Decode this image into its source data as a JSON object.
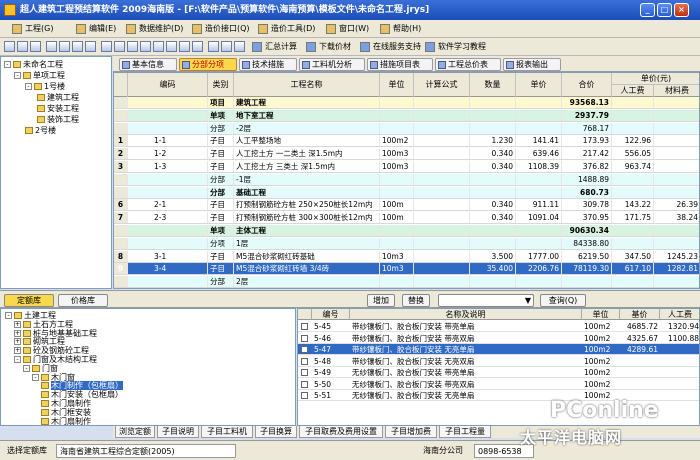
{
  "window": {
    "title": "超人建筑工程预结算软件 2009海南版 - [F:\\软件产品\\预算软件\\海南预算\\模板文件\\未命名工程.jrys]"
  },
  "menu": [
    "工程(G)",
    "编辑(E)",
    "数据维护(D)",
    "造价接口(Q)",
    "造价工具(D)",
    "窗口(W)",
    "帮助(H)"
  ],
  "toolbar": {
    "summary": "汇总计算",
    "download": "下载价材",
    "online": "在线服务支持",
    "tutorial": "软件学习教程"
  },
  "project_tree": [
    {
      "label": "未命名工程",
      "level": 0,
      "toggle": "-"
    },
    {
      "label": "单项工程",
      "level": 1,
      "toggle": "-"
    },
    {
      "label": "1号楼",
      "level": 2,
      "toggle": "-"
    },
    {
      "label": "建筑工程",
      "level": 3,
      "toggle": ""
    },
    {
      "label": "安装工程",
      "level": 3,
      "toggle": ""
    },
    {
      "label": "装饰工程",
      "level": 3,
      "toggle": ""
    },
    {
      "label": "2号楼",
      "level": 2,
      "toggle": ""
    }
  ],
  "tabs": [
    "基本信息",
    "分部分项",
    "技术措施",
    "工料机分析",
    "措施项目表",
    "工程总价表",
    "报表输出"
  ],
  "grid": {
    "headers": {
      "code": "编码",
      "type": "类别",
      "name": "工程名称",
      "unit": "单位",
      "formula": "计算公式",
      "qty": "数量",
      "price": "单价",
      "total": "合价",
      "unit_price": "单价(元)",
      "labor": "人工费",
      "material": "材料费"
    },
    "rows": [
      {
        "n": "",
        "code": "",
        "type": "项目",
        "name": "建筑工程",
        "unit": "",
        "formula": "",
        "qty": "",
        "price": "",
        "total": "93568.13",
        "labor": "",
        "mat": "",
        "style": "bg-yellow bold"
      },
      {
        "n": "",
        "code": "",
        "type": "单项",
        "name": "地下室工程",
        "unit": "",
        "formula": "",
        "qty": "",
        "price": "",
        "total": "2937.79",
        "labor": "",
        "mat": "",
        "style": "bg-green bold"
      },
      {
        "n": "",
        "code": "",
        "type": "分部",
        "name": "-2层",
        "unit": "",
        "formula": "",
        "qty": "",
        "price": "",
        "total": "768.17",
        "labor": "",
        "mat": "",
        "style": "bg-cyan"
      },
      {
        "n": "1",
        "code": "1-1",
        "type": "子目",
        "name": "人工平整场地",
        "unit": "100m2",
        "formula": "",
        "qty": "1.230",
        "price": "141.41",
        "total": "173.93",
        "labor": "122.96",
        "mat": "",
        "style": ""
      },
      {
        "n": "2",
        "code": "1-2",
        "type": "子目",
        "name": "人工挖土方 一二类土 深1.5m内",
        "unit": "100m3",
        "formula": "",
        "qty": "0.340",
        "price": "639.46",
        "total": "217.42",
        "labor": "556.05",
        "mat": "",
        "style": ""
      },
      {
        "n": "3",
        "code": "1-3",
        "type": "子目",
        "name": "人工挖土方 三类土 深1.5m内",
        "unit": "100m3",
        "formula": "",
        "qty": "0.340",
        "price": "1108.39",
        "total": "376.82",
        "labor": "963.74",
        "mat": "",
        "style": ""
      },
      {
        "n": "",
        "code": "",
        "type": "分部",
        "name": "-1层",
        "unit": "",
        "formula": "",
        "qty": "",
        "price": "",
        "total": "1488.89",
        "labor": "",
        "mat": "",
        "style": "bg-cyan"
      },
      {
        "n": "",
        "code": "",
        "type": "分部",
        "name": "基础工程",
        "unit": "",
        "formula": "",
        "qty": "",
        "price": "",
        "total": "680.73",
        "labor": "",
        "mat": "",
        "style": "bg-cyan bold"
      },
      {
        "n": "6",
        "code": "2-1",
        "type": "子目",
        "name": "打预制钢筋砼方桩 250×250桩长12m内",
        "unit": "100m",
        "formula": "",
        "qty": "0.340",
        "price": "911.11",
        "total": "309.78",
        "labor": "143.22",
        "mat": "26.39",
        "style": ""
      },
      {
        "n": "7",
        "code": "2-3",
        "type": "子目",
        "name": "打预制钢筋砼方桩 300×300桩长12m内",
        "unit": "100m",
        "formula": "",
        "qty": "0.340",
        "price": "1091.04",
        "total": "370.95",
        "labor": "171.75",
        "mat": "38.24",
        "style": ""
      },
      {
        "n": "",
        "code": "",
        "type": "单项",
        "name": "主体工程",
        "unit": "",
        "formula": "",
        "qty": "",
        "price": "",
        "total": "90630.34",
        "labor": "",
        "mat": "",
        "style": "bg-green bold"
      },
      {
        "n": "",
        "code": "",
        "type": "分项",
        "name": "1层",
        "unit": "",
        "formula": "",
        "qty": "",
        "price": "",
        "total": "84338.80",
        "labor": "",
        "mat": "",
        "style": "bg-cyan"
      },
      {
        "n": "8",
        "code": "3-1",
        "type": "子目",
        "name": "M5混合砂浆砌红砖基础",
        "unit": "10m3",
        "formula": "",
        "qty": "3.500",
        "price": "1777.00",
        "total": "6219.50",
        "labor": "347.50",
        "mat": "1245.23",
        "style": ""
      },
      {
        "n": "9",
        "code": "3-4",
        "type": "子目",
        "name": "M5混合砂浆砌红砖墙 3/4砖",
        "unit": "10m3",
        "formula": "",
        "qty": "35.400",
        "price": "2206.76",
        "total": "78119.30",
        "labor": "617.10",
        "mat": "1282.81",
        "style": "sel"
      },
      {
        "n": "",
        "code": "",
        "type": "分部",
        "name": "2层",
        "unit": "",
        "formula": "",
        "qty": "",
        "price": "",
        "total": "",
        "labor": "",
        "mat": "",
        "style": "bg-cyan"
      }
    ]
  },
  "midbar": {
    "tab1": "定额库",
    "tab2": "价格库",
    "add": "增加",
    "replace": "替换",
    "query": "查询(Q)"
  },
  "lib_tree": [
    {
      "label": "土建工程",
      "level": 0,
      "toggle": "-"
    },
    {
      "label": "土石方工程",
      "level": 1,
      "toggle": "+"
    },
    {
      "label": "桩与地基基础工程",
      "level": 1,
      "toggle": "+"
    },
    {
      "label": "砌筑工程",
      "level": 1,
      "toggle": "+"
    },
    {
      "label": "砼及钢筋砼工程",
      "level": 1,
      "toggle": "+"
    },
    {
      "label": "门窗及木结构工程",
      "level": 1,
      "toggle": "-"
    },
    {
      "label": "门窗",
      "level": 2,
      "toggle": "-"
    },
    {
      "label": "木门窗",
      "level": 3,
      "toggle": "-"
    },
    {
      "label": "木门制作（包框扇）",
      "level": 4,
      "toggle": "",
      "sel": true
    },
    {
      "label": "木门安装（包框扇）",
      "level": 4,
      "toggle": ""
    },
    {
      "label": "木门扇制作",
      "level": 4,
      "toggle": ""
    },
    {
      "label": "木门框安装",
      "level": 4,
      "toggle": ""
    },
    {
      "label": "木门扇制作",
      "level": 4,
      "toggle": ""
    }
  ],
  "lib_grid": {
    "headers": {
      "no": "编号",
      "name": "名称及说明",
      "unit": "单位",
      "base": "基价",
      "labor": "人工费"
    },
    "rows": [
      {
        "no": "5-45",
        "name": "带纱镶板门、胶合板门安装 带亮单扇",
        "unit": "100m2",
        "base": "4685.72",
        "labor": "1320.94",
        "sel": false
      },
      {
        "no": "5-46",
        "name": "带纱镶板门、胶合板门安装 带亮双扇",
        "unit": "100m2",
        "base": "4325.67",
        "labor": "1100.88",
        "sel": false
      },
      {
        "no": "5-47",
        "name": "带纱镶板门、胶合板门安装 无亮单扇",
        "unit": "100m2",
        "base": "4289.61",
        "labor": "",
        "sel": true
      },
      {
        "no": "5-48",
        "name": "带纱镶板门、胶合板门安装 无亮双扇",
        "unit": "100m2",
        "base": "",
        "labor": "",
        "sel": false
      },
      {
        "no": "5-49",
        "name": "无纱镶板门、胶合板门安装 带亮单扇",
        "unit": "100m2",
        "base": "",
        "labor": "",
        "sel": false
      },
      {
        "no": "5-50",
        "name": "无纱镶板门、胶合板门安装 带亮双扇",
        "unit": "100m2",
        "base": "",
        "labor": "",
        "sel": false
      },
      {
        "no": "5-51",
        "name": "无纱镶板门、胶合板门安装 无亮单扇",
        "unit": "100m2",
        "base": "",
        "labor": "",
        "sel": false
      }
    ]
  },
  "bottom_tabs": [
    "浏览定额",
    "子目说明",
    "子目工料机",
    "子目换算",
    "子目取费及费用设置",
    "子目增加费",
    "子目工程量"
  ],
  "status": {
    "label": "选择定额库",
    "library": "海南省建筑工程综合定额(2005)",
    "branch": "海南分公司",
    "phone": "0898-6538"
  },
  "watermark": {
    "brand": "PConline",
    "cn": "太平洋电脑网"
  }
}
